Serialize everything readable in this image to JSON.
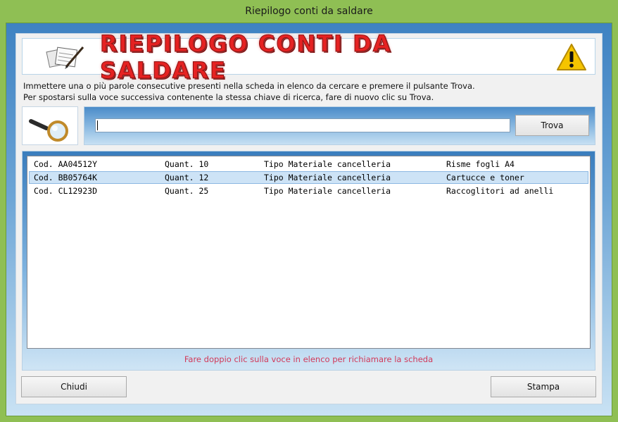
{
  "window": {
    "title": "Riepilogo conti da saldare"
  },
  "banner": {
    "title": "RIEPILOGO CONTI DA SALDARE"
  },
  "info": {
    "line1": "Immettere una o più parole consecutive presenti nella scheda in elenco da cercare e premere il pulsante Trova.",
    "line2": "Per spostarsi sulla voce successiva contenente la stessa chiave di ricerca, fare di nuovo clic su Trova."
  },
  "search": {
    "value": "",
    "button_label": "Trova"
  },
  "list": {
    "rows": [
      {
        "cod": "Cod. AA04512Y",
        "quant": "Quant. 10",
        "tipo": "Tipo Materiale cancelleria",
        "desc": "Risme fogli A4",
        "selected": false
      },
      {
        "cod": "Cod. BB05764K",
        "quant": "Quant. 12",
        "tipo": "Tipo Materiale cancelleria",
        "desc": "Cartucce e toner",
        "selected": true
      },
      {
        "cod": "Cod. CL12923D",
        "quant": "Quant. 25",
        "tipo": "Tipo Materiale cancelleria",
        "desc": "Raccoglitori ad anelli",
        "selected": false
      }
    ]
  },
  "hint": "Fare doppio clic sulla voce in elenco per richiamare la scheda",
  "buttons": {
    "close": "Chiudi",
    "print": "Stampa"
  },
  "icons": {
    "banner_left": "documents-pen-icon",
    "banner_right": "warning-icon",
    "search": "magnifier-icon"
  },
  "colors": {
    "frame": "#8fbf54",
    "title_red": "#e52222",
    "hint": "#d23a5a",
    "selection": "#cde3f6"
  }
}
